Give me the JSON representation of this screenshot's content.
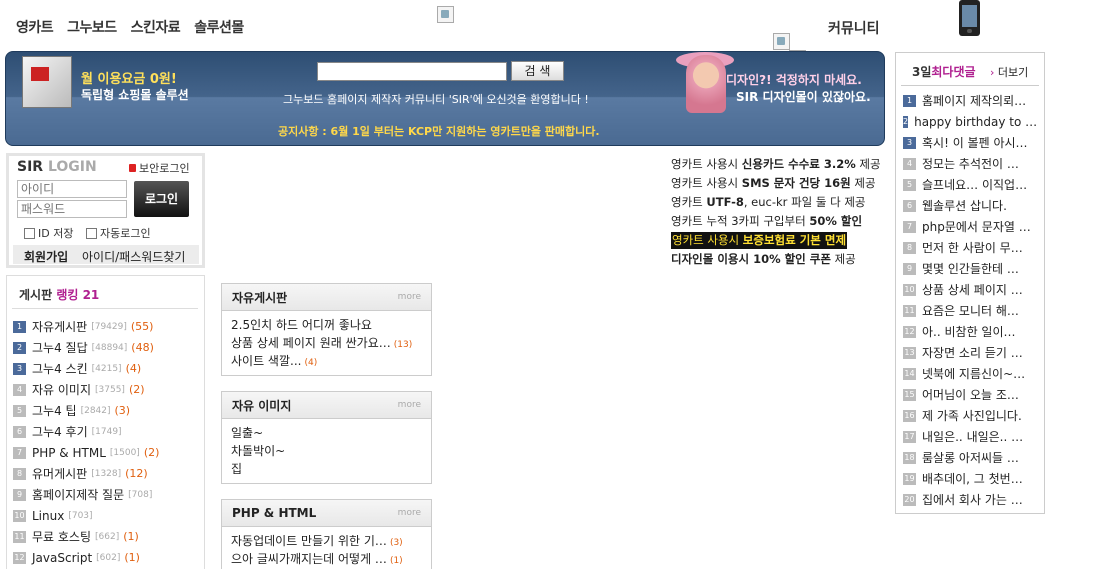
{
  "nav": {
    "items": [
      "영카트",
      "그누보드",
      "스킨자료",
      "솔루션몰"
    ],
    "community": "커뮤니티"
  },
  "banner": {
    "promo_left_1": "월 이용요금 0원!",
    "promo_left_2": "독립형 쇼핑몰 솔루션",
    "search_placeholder": "",
    "search_button": "검 색",
    "welcome": "그누보드 홈페이지 제작자 커뮤니티 'SIR'에 오신것을 환영합니다 !",
    "notice_label": "공지사항 : ",
    "notice_text": "6월 1일 부터는 KCP만 지원하는 영카트만을 판매합니다.",
    "promo_right_1": "디자인?! 걱정하지 마세요.",
    "promo_right_2": "SIR 디자인몰이 있잖아요."
  },
  "login": {
    "title_sir": "SIR",
    "title_login": "LOGIN",
    "secure_login": "보안로그인",
    "id_placeholder": "아이디",
    "pw_placeholder": "패스워드",
    "login_button": "로그인",
    "save_id": "ID 저장",
    "auto_login": "자동로그인",
    "join": "회원가입",
    "find": "아이디/패스워드찾기"
  },
  "promos": [
    {
      "pre": "영카트 사용시 ",
      "bold": "신용카드 수수료 3.2%",
      "post": " 제공"
    },
    {
      "pre": "영카트 사용시 ",
      "bold": "SMS 문자 건당 16원",
      "post": " 제공"
    },
    {
      "pre": "영카트 ",
      "bold": "UTF-8",
      "post": ", euc-kr 파일 둘 다 제공"
    },
    {
      "pre": "영카트 누적 3카피 구입부터 ",
      "bold": "50% 할인",
      "post": ""
    },
    {
      "pre": "영카트 사용시 ",
      "bold": "보증보험료 기본 면제",
      "post": ""
    },
    {
      "pre": "디자인몰 ",
      "bold": "이용시 10% 할인 쿠폰",
      "post": " 제공"
    }
  ],
  "ranking": {
    "title_pre": "게시판 ",
    "title_hl": "랭킹 21",
    "items": [
      {
        "n": "1",
        "name": "자유게시판",
        "count": "[79429]",
        "new": "(55)"
      },
      {
        "n": "2",
        "name": "그누4 질답",
        "count": "[48894]",
        "new": "(48)"
      },
      {
        "n": "3",
        "name": "그누4 스킨",
        "count": "[4215]",
        "new": "(4)"
      },
      {
        "n": "4",
        "name": "자유 이미지",
        "count": "[3755]",
        "new": "(2)"
      },
      {
        "n": "5",
        "name": "그누4 팁",
        "count": "[2842]",
        "new": "(3)"
      },
      {
        "n": "6",
        "name": "그누4 후기",
        "count": "[1749]",
        "new": ""
      },
      {
        "n": "7",
        "name": "PHP & HTML",
        "count": "[1500]",
        "new": "(2)"
      },
      {
        "n": "8",
        "name": "유머게시판",
        "count": "[1328]",
        "new": "(12)"
      },
      {
        "n": "9",
        "name": "홈페이지제작 질문",
        "count": "[708]",
        "new": ""
      },
      {
        "n": "10",
        "name": "Linux",
        "count": "[703]",
        "new": ""
      },
      {
        "n": "11",
        "name": "무료 호스팅",
        "count": "[662]",
        "new": "(1)"
      },
      {
        "n": "12",
        "name": "JavaScript",
        "count": "[602]",
        "new": "(1)"
      }
    ]
  },
  "boards": [
    {
      "title": "자유게시판",
      "more": "more",
      "posts": [
        {
          "t": "2.5인치 하드 어디꺼 좋나요",
          "c": ""
        },
        {
          "t": "상품 상세 페이지 원래 싼가요…",
          "c": "(13)"
        },
        {
          "t": "사이트 색깔...",
          "c": "(4)"
        }
      ]
    },
    {
      "title": "자유 이미지",
      "more": "more",
      "posts": [
        {
          "t": "일출~",
          "c": ""
        },
        {
          "t": "차돌박이~",
          "c": ""
        },
        {
          "t": "집",
          "c": ""
        }
      ]
    },
    {
      "title": "PHP & HTML",
      "more": "more",
      "posts": [
        {
          "t": "자동업데이트 만들기 위한 기…",
          "c": "(3)"
        },
        {
          "t": "으아 글씨가깨지는데 어떻게 …",
          "c": "(1)"
        }
      ]
    }
  ],
  "hot": {
    "title_pre": "3일",
    "title_hl": "최다댓글",
    "more_arrow": "›",
    "more": "더보기",
    "items": [
      "홈페이지 제작의뢰…",
      "happy birthday to …",
      "혹시! 이 볼펜 아시…",
      "정모는 추석전이 …",
      "슬프네요… 이직업…",
      "웹솔루션 삽니다.",
      "php문에서 문자열 …",
      "먼저 한 사람이 무…",
      "몇몇 인간들한테 …",
      "상품 상세 페이지 …",
      "요즘은 모니터 해…",
      "아.. 비참한 일이…",
      "자장면 소리 듣기 …",
      "넷북에 지름신이~…",
      "어머님이 오늘 조…",
      "제 가족 사진입니다.",
      "내일은.. 내일은.. …",
      "룸살롱 아저씨들 …",
      "배추데이, 그 첫번…",
      "집에서 회사 가는 …"
    ]
  },
  "colors": {
    "banner": "#3a5a80",
    "accent_pink": "#b02090",
    "new_count": "#e06010",
    "rank_top": "#4b6a9a"
  }
}
